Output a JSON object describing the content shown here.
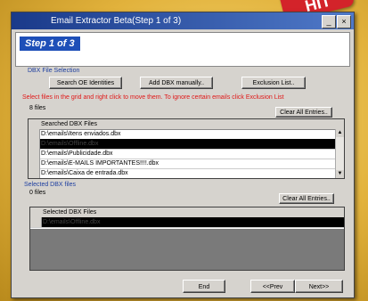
{
  "badge": "HIT",
  "window": {
    "title": "Email Extractor Beta(Step 1 of 3)"
  },
  "header": {
    "step_label": "Step 1 of 3"
  },
  "group_top": {
    "label": "DBX File Selection"
  },
  "buttons": {
    "search_oe": "Search OE Identities",
    "add_dbx": "Add DBX manually..",
    "exclusion": "Exclusion List..",
    "clear_all_1": "Clear All Entries..",
    "clear_all_2": "Clear All Entries..",
    "end": "End",
    "prev": "<<Prev",
    "next": "Next>>"
  },
  "instruction": "Select files in the grid and right click to move them. To ignore certain emails click Exclusion List",
  "searched": {
    "count": "8 files",
    "header": "Searched DBX Files",
    "rows": [
      "D:\\emails\\Itens enviados.dbx",
      "D:\\emails\\Offline.dbx",
      "D:\\emails\\Publicidade.dbx",
      "D:\\emails\\E-MAILS IMPORTANTES!!!!.dbx",
      "D:\\emails\\Caixa de entrada.dbx"
    ]
  },
  "group_bottom": {
    "label": "Selected DBX files"
  },
  "selected": {
    "count": "0 files",
    "header": "Selected DBX Files",
    "rows": [
      "D:\\emails\\Offline.dbx"
    ]
  }
}
